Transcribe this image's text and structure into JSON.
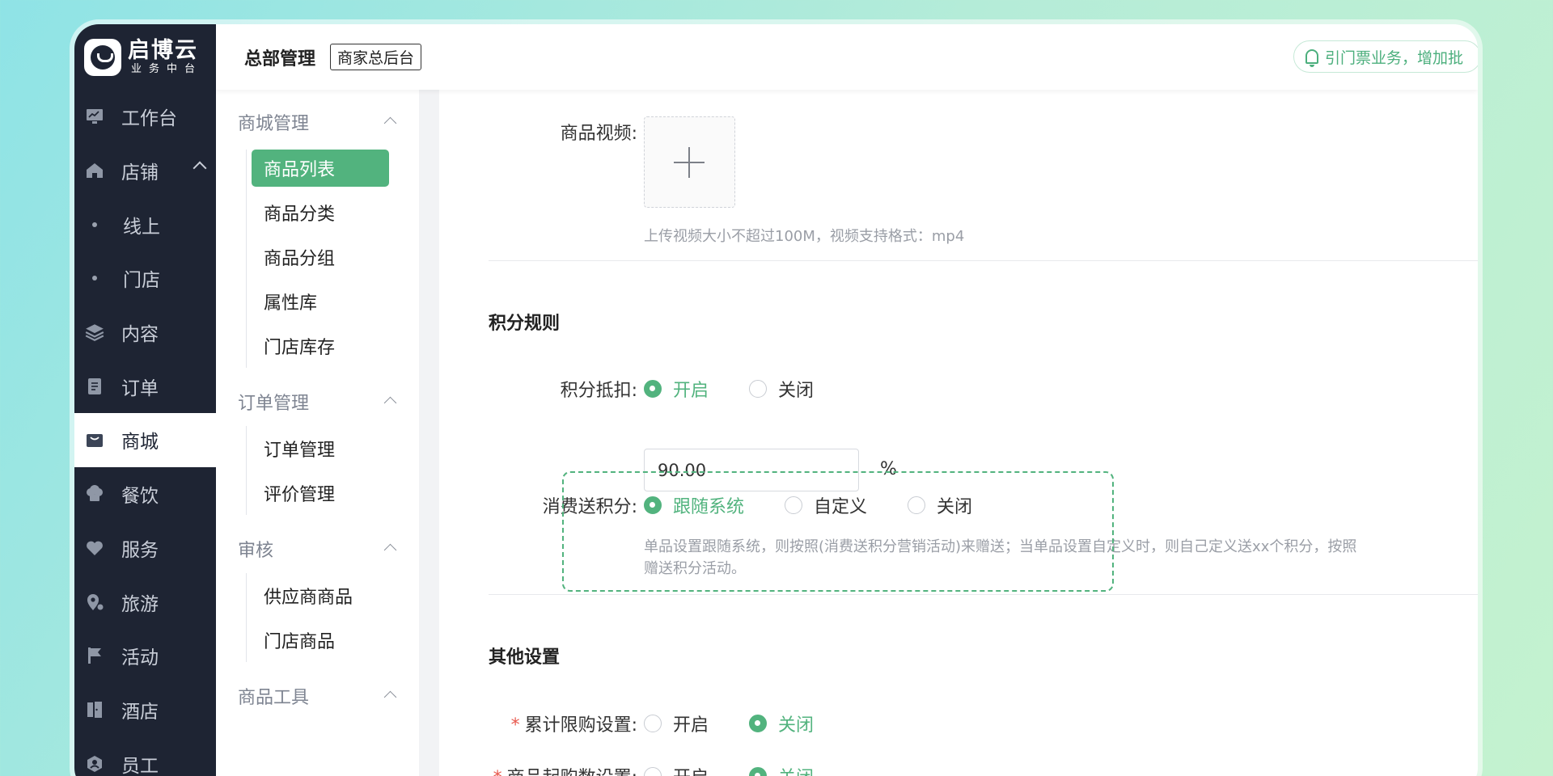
{
  "sidebar": {
    "logo_name": "启博云",
    "logo_sub": "业务中台",
    "items": [
      {
        "label": "工作台",
        "icon": "monitor-icon"
      },
      {
        "label": "店铺",
        "icon": "home-icon"
      },
      {
        "label": "线上",
        "icon": "dot"
      },
      {
        "label": "门店",
        "icon": "dot"
      },
      {
        "label": "内容",
        "icon": "layers-icon"
      },
      {
        "label": "订单",
        "icon": "document-icon"
      },
      {
        "label": "商城",
        "icon": "shop-bag-icon"
      },
      {
        "label": "餐饮",
        "icon": "chef-hat-icon"
      },
      {
        "label": "服务",
        "icon": "heart-icon"
      },
      {
        "label": "旅游",
        "icon": "map-pin-icon"
      },
      {
        "label": "活动",
        "icon": "flag-icon"
      },
      {
        "label": "酒店",
        "icon": "door-icon"
      },
      {
        "label": "员工",
        "icon": "staff-icon"
      }
    ]
  },
  "header": {
    "title": "总部管理",
    "tag": "商家总后台",
    "notice": "引门票业务，增加批"
  },
  "submenu": {
    "groups": [
      {
        "title": "商城管理",
        "items": [
          "商品列表",
          "商品分类",
          "商品分组",
          "属性库",
          "门店库存"
        ]
      },
      {
        "title": "订单管理",
        "items": [
          "订单管理",
          "评价管理"
        ]
      },
      {
        "title": "审核",
        "items": [
          "供应商商品",
          "门店商品"
        ]
      },
      {
        "title": "商品工具",
        "items": []
      }
    ]
  },
  "form": {
    "video_label": "商品视频:",
    "video_hint": "上传视频大小不超过100M，视频支持格式：mp4",
    "points_section": "积分规则",
    "deduct_label": "积分抵扣:",
    "deduct_on": "开启",
    "deduct_off": "关闭",
    "deduct_value": "90.00",
    "deduct_unit": "%",
    "gift_label": "消费送积分:",
    "gift_follow": "跟随系统",
    "gift_custom": "自定义",
    "gift_off": "关闭",
    "gift_hint_1": "单品设置跟随系统，则按照(消费送积分营销活动)来赠送；当单品设置自定义时，则自己定义送xx个积分，按照",
    "gift_hint_2": "赠送积分活动。",
    "other_section": "其他设置",
    "limit_label": "累计限购设置:",
    "limit_on": "开启",
    "limit_off": "关闭",
    "min_label": "商品起购数设置:",
    "min_on": "开启",
    "min_off": "关闭",
    "required_mark": "*"
  },
  "colors": {
    "accent": "#52b37e",
    "sidebar_bg": "#1e2433",
    "highlight": "#52b37e"
  }
}
